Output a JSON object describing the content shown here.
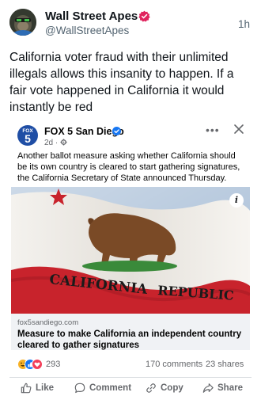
{
  "post": {
    "author_name": "Wall Street Apes",
    "author_handle": "@WallStreetApes",
    "time": "1h",
    "text": "California voter fraud with their unlimited illegals allows this insanity to happen. If a fair vote happened in California it would instantly be red"
  },
  "embed": {
    "page_name": "FOX 5 San Diego",
    "logo_top": "FOX",
    "logo_number": "5",
    "post_age": "2d ·",
    "more_label": "•••",
    "text": "Another ballot measure asking whether California should be its own country is cleared to start gathering signatures, the California Secretary of State announced Thursday.",
    "info_label": "i",
    "flag_text_left": "CALIFORNIA",
    "flag_text_right": "REPUBLIC",
    "link_domain": "fox5sandiego.com",
    "link_title": "Measure to make California an independent country cleared to gather signatures",
    "reaction_count": "293",
    "comment_count": "170 comments",
    "share_count": "23 shares",
    "actions": {
      "like": "Like",
      "comment": "Comment",
      "copy": "Copy",
      "share": "Share"
    }
  },
  "colors": {
    "verified_badge": "#e0245e",
    "fb_verified": "#1877f2",
    "fox_blue": "#1f4ea5",
    "muted_text": "#65676b",
    "link_background": "#f0f2f5"
  }
}
